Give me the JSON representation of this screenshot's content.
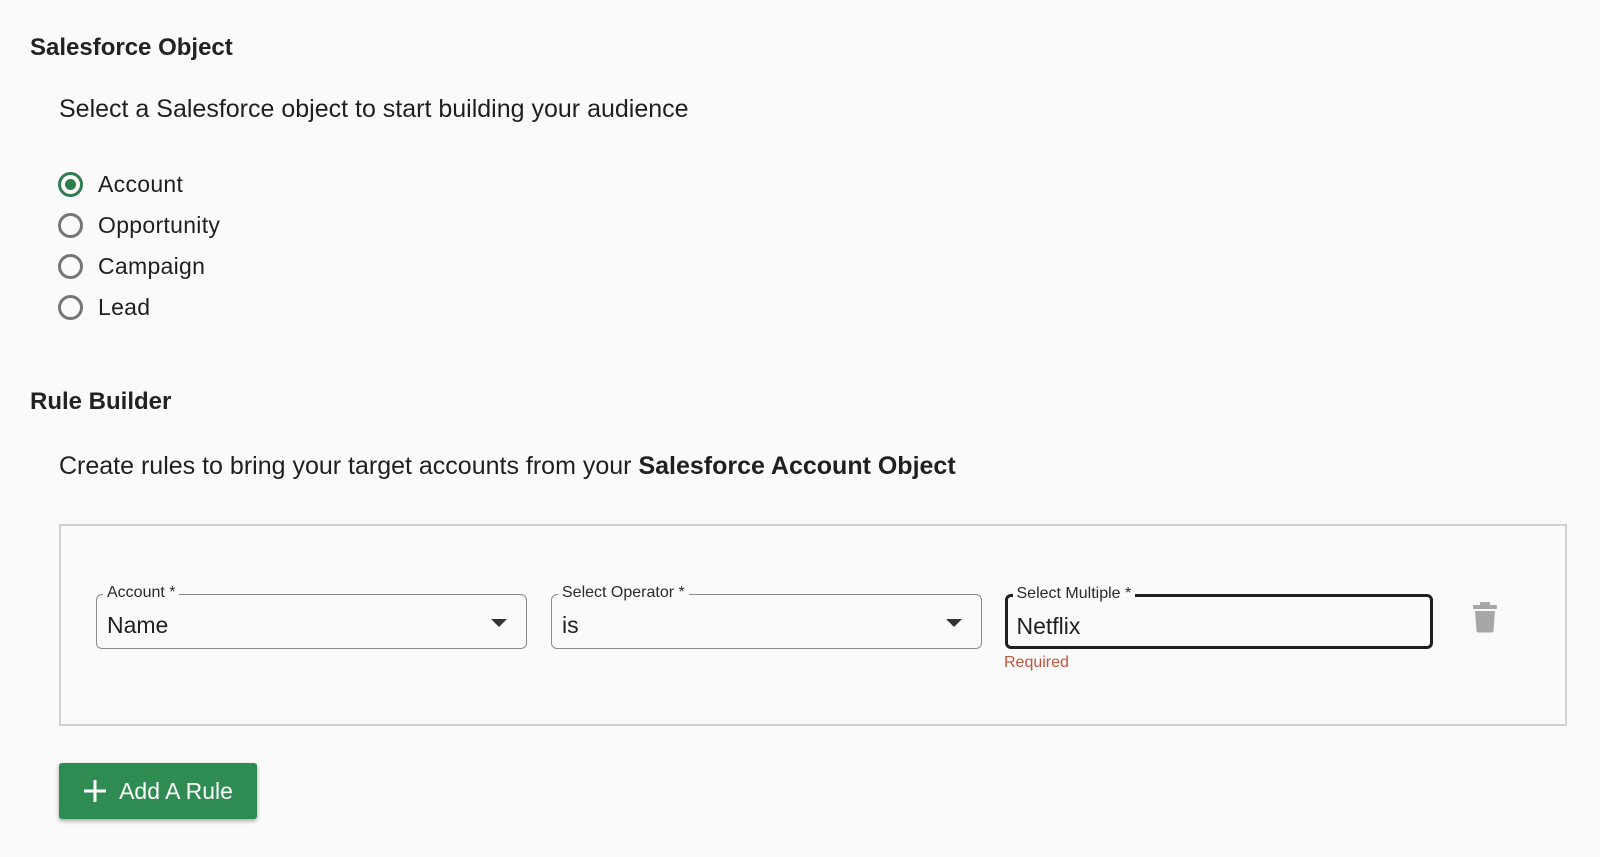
{
  "salesforce_object": {
    "title": "Salesforce Object",
    "description": "Select a Salesforce object to start building your audience",
    "options": [
      {
        "label": "Account",
        "selected": true
      },
      {
        "label": "Opportunity",
        "selected": false
      },
      {
        "label": "Campaign",
        "selected": false
      },
      {
        "label": "Lead",
        "selected": false
      }
    ]
  },
  "rule_builder": {
    "title": "Rule Builder",
    "description_prefix": "Create rules to bring your target accounts from your ",
    "description_bold": "Salesforce Account Object",
    "rule": {
      "field1": {
        "label": "Account *",
        "value": "Name"
      },
      "field2": {
        "label": "Select Operator *",
        "value": "is"
      },
      "field3": {
        "label": "Select Multiple *",
        "value": "Netflix",
        "helper": "Required"
      }
    },
    "add_button_label": "Add A Rule"
  },
  "colors": {
    "accent_green": "#2e8b51",
    "radio_checked": "#2e7d4f",
    "error": "#c0533b"
  },
  "icons": {
    "delete": "trash-icon",
    "add": "plus-icon",
    "dropdown": "caret-down-icon"
  }
}
